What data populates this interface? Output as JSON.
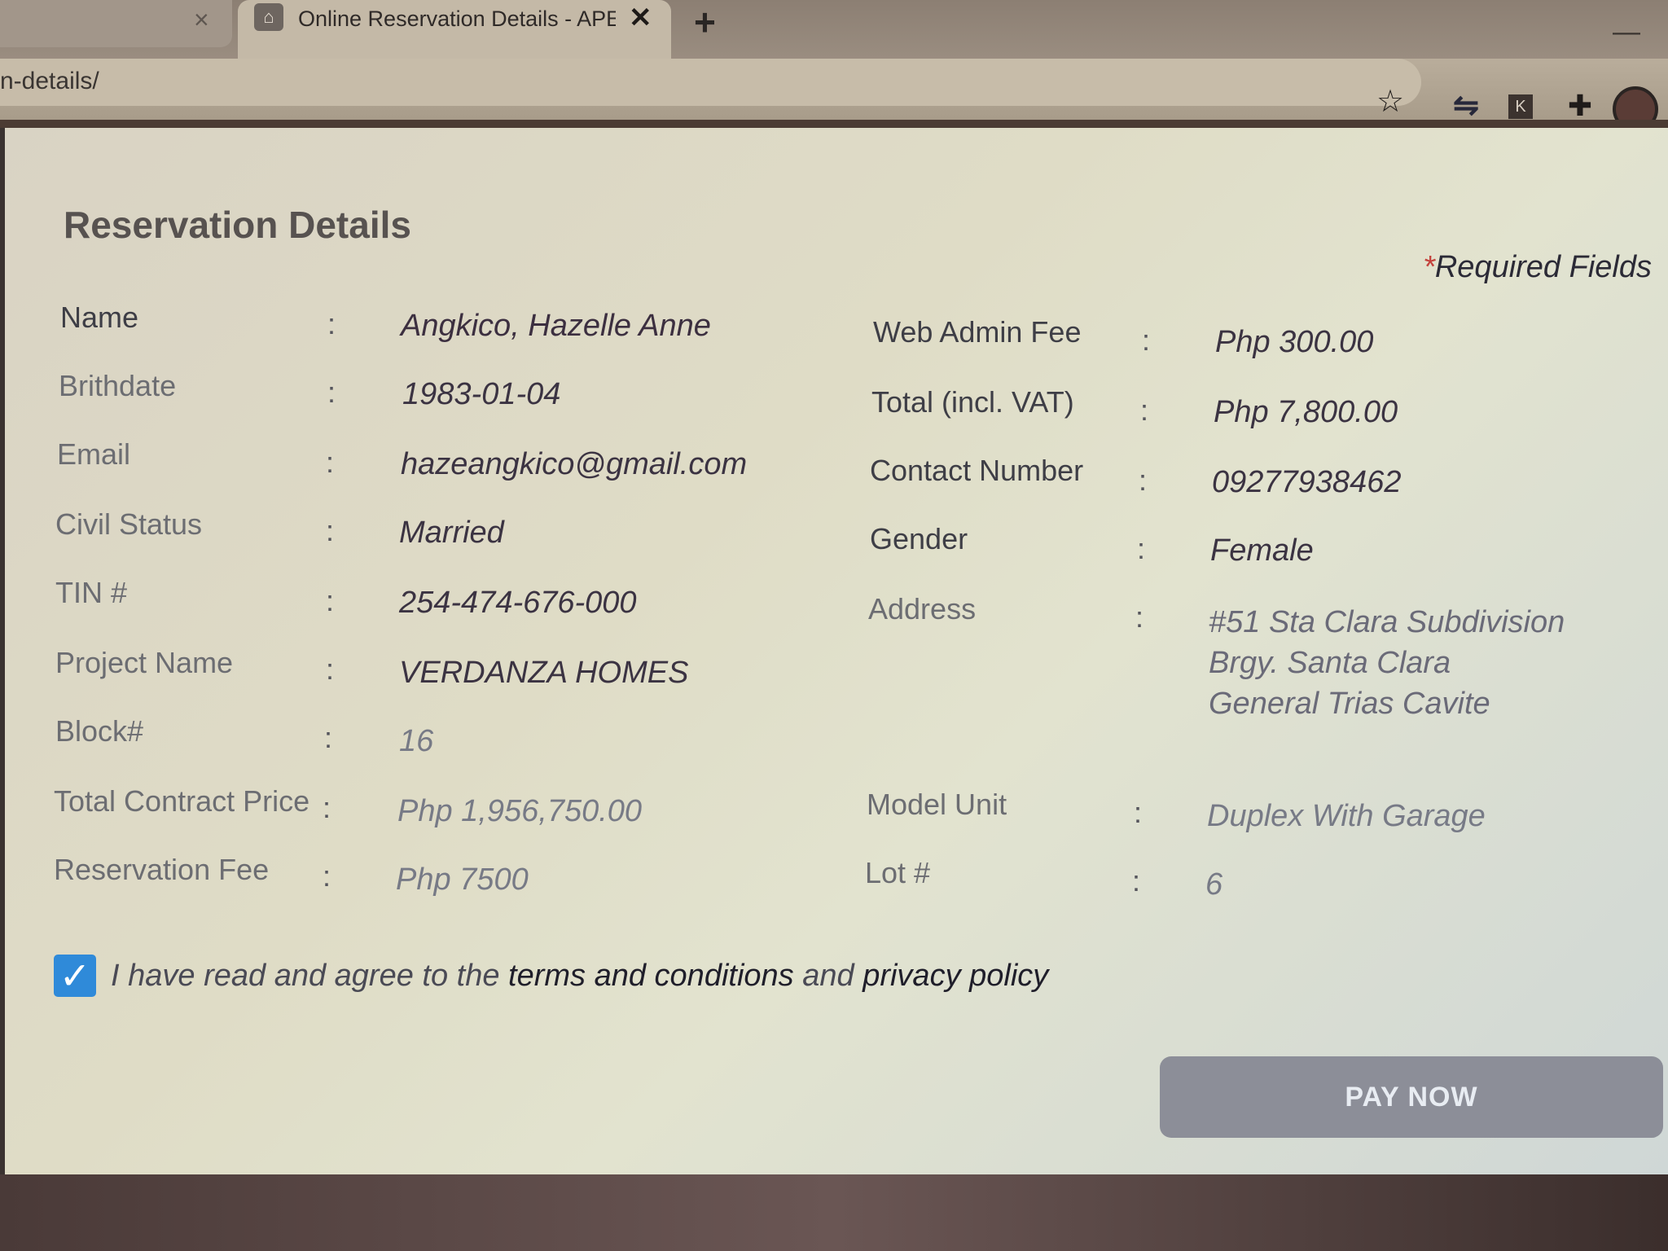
{
  "browser": {
    "prev_tab_close": "×",
    "active_tab_title": "Online Reservation Details - APEC",
    "active_tab_close": "✕",
    "new_tab": "+",
    "window_minimize": "—",
    "url": "n-details/"
  },
  "page": {
    "title": "Reservation Details",
    "required_asterisk": "*",
    "required_text": "Required Fields"
  },
  "left_fields": [
    {
      "label": "Name",
      "value": "Angkico, Hazelle Anne"
    },
    {
      "label": "Brithdate",
      "value": "1983-01-04"
    },
    {
      "label": "Email",
      "value": "hazeangkico@gmail.com"
    },
    {
      "label": "Civil Status",
      "value": "Married"
    },
    {
      "label": "TIN #",
      "value": "254-474-676-000"
    },
    {
      "label": "Project Name",
      "value": "VERDANZA HOMES"
    },
    {
      "label": "Block#",
      "value": "16"
    },
    {
      "label": "Total Contract Price",
      "value": "Php 1,956,750.00"
    },
    {
      "label": "Reservation Fee",
      "value": "Php 7500"
    }
  ],
  "right_fields": [
    {
      "label": "Web Admin Fee",
      "value": "Php 300.00"
    },
    {
      "label": "Total (incl. VAT)",
      "value": "Php 7,800.00"
    },
    {
      "label": "Contact Number",
      "value": "09277938462"
    },
    {
      "label": "Gender",
      "value": "Female"
    },
    {
      "label": "Address",
      "value": "#51 Sta Clara Subdivision Brgy. Santa Clara General Trias Cavite"
    },
    {
      "label": "Model Unit",
      "value": "Duplex With Garage"
    },
    {
      "label": "Lot #",
      "value": "6"
    }
  ],
  "colon": ":",
  "agreement": {
    "checked": true,
    "prefix": "I have read and agree to the ",
    "terms_link": "terms and conditions",
    "middle": " and ",
    "privacy_link": "privacy policy"
  },
  "pay_button": "PAY NOW",
  "icons": {
    "favicon": "apec-favicon-icon",
    "bookmark": "star-icon",
    "sync": "sync-extension-icon",
    "k_ext": "k-extension-icon",
    "extensions": "puzzle-icon",
    "checkbox": "check-icon"
  },
  "colors": {
    "checkbox": "#2f8ad9",
    "pay_button": "#8c8e98",
    "required_asterisk": "#c4423c"
  }
}
